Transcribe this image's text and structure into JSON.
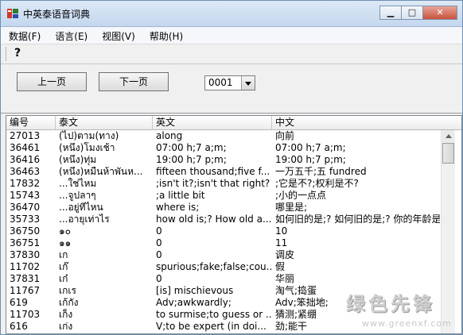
{
  "window": {
    "title": "中英泰语音词典"
  },
  "menu": [
    {
      "label": "数据(F)"
    },
    {
      "label": "语言(E)"
    },
    {
      "label": "视图(V)"
    },
    {
      "label": "帮助(H)"
    }
  ],
  "toolbar": {
    "help_glyph": "?"
  },
  "nav": {
    "prev_label": "上一页",
    "next_label": "下一页",
    "page_value": "0001"
  },
  "table": {
    "headers": [
      "编号",
      "泰文",
      "英文",
      "中文"
    ],
    "rows": [
      [
        "27013",
        "(ไป)ตาม(ทาง)",
        "along",
        "向前"
      ],
      [
        "36461",
        "(หนึ่ง)โมงเช้า",
        "07:00 h;7 a;m;",
        "07:00 h;7 a;m;"
      ],
      [
        "36416",
        "(หนึ่ง)ทุ่ม",
        "19:00 h;7 p;m;",
        "19:00 h;7 p;m;"
      ],
      [
        "36463",
        "(หนึ่ง)หมื่นห้าพันห...",
        "fifteen thousand;five f...",
        "一万五千;五 fundred"
      ],
      [
        "17832",
        "...ใช่ไหม",
        ";isn't it?;isn't that right?",
        ";它是不?;权利是不?"
      ],
      [
        "15743",
        "...จูปลาๆ",
        ";a little bit",
        ";小的一点点"
      ],
      [
        "36470",
        "...อยู่ที่ไหน",
        "where is;",
        "哪里是;"
      ],
      [
        "35733",
        "...อายุเท่าไร",
        "how old is;? How old a...",
        "如何旧的是;? 如何旧的是;? 你的年龄是"
      ],
      [
        "36750",
        "๑๐",
        "0",
        "10"
      ],
      [
        "36751",
        "๑๑",
        "0",
        "11"
      ],
      [
        "37830",
        "เก",
        "0",
        "调皮"
      ],
      [
        "11702",
        "เก๊",
        "spurious;fake;false;cou...",
        "假"
      ],
      [
        "37831",
        "เก๋",
        "0",
        "华丽"
      ],
      [
        "11767",
        "เกเร",
        "[is] mischievous",
        "淘气;捣蛋"
      ],
      [
        "619",
        "เก้กัง",
        " Adv;awkwardly;",
        "Adv;笨拙地;"
      ],
      [
        "11703",
        "เก็ง",
        "to surmise;to guess or ...",
        "猜测;紧绷"
      ],
      [
        "616",
        "เก่ง",
        " V;to be expert (in doi...",
        "劲;能干"
      ]
    ]
  },
  "watermark": {
    "text": "绿色先锋",
    "url": "www.greenxf.com"
  },
  "colors": {
    "titlebar": "#c4d7ee",
    "close": "#c7523d",
    "grid_bg": "#ffffff"
  }
}
